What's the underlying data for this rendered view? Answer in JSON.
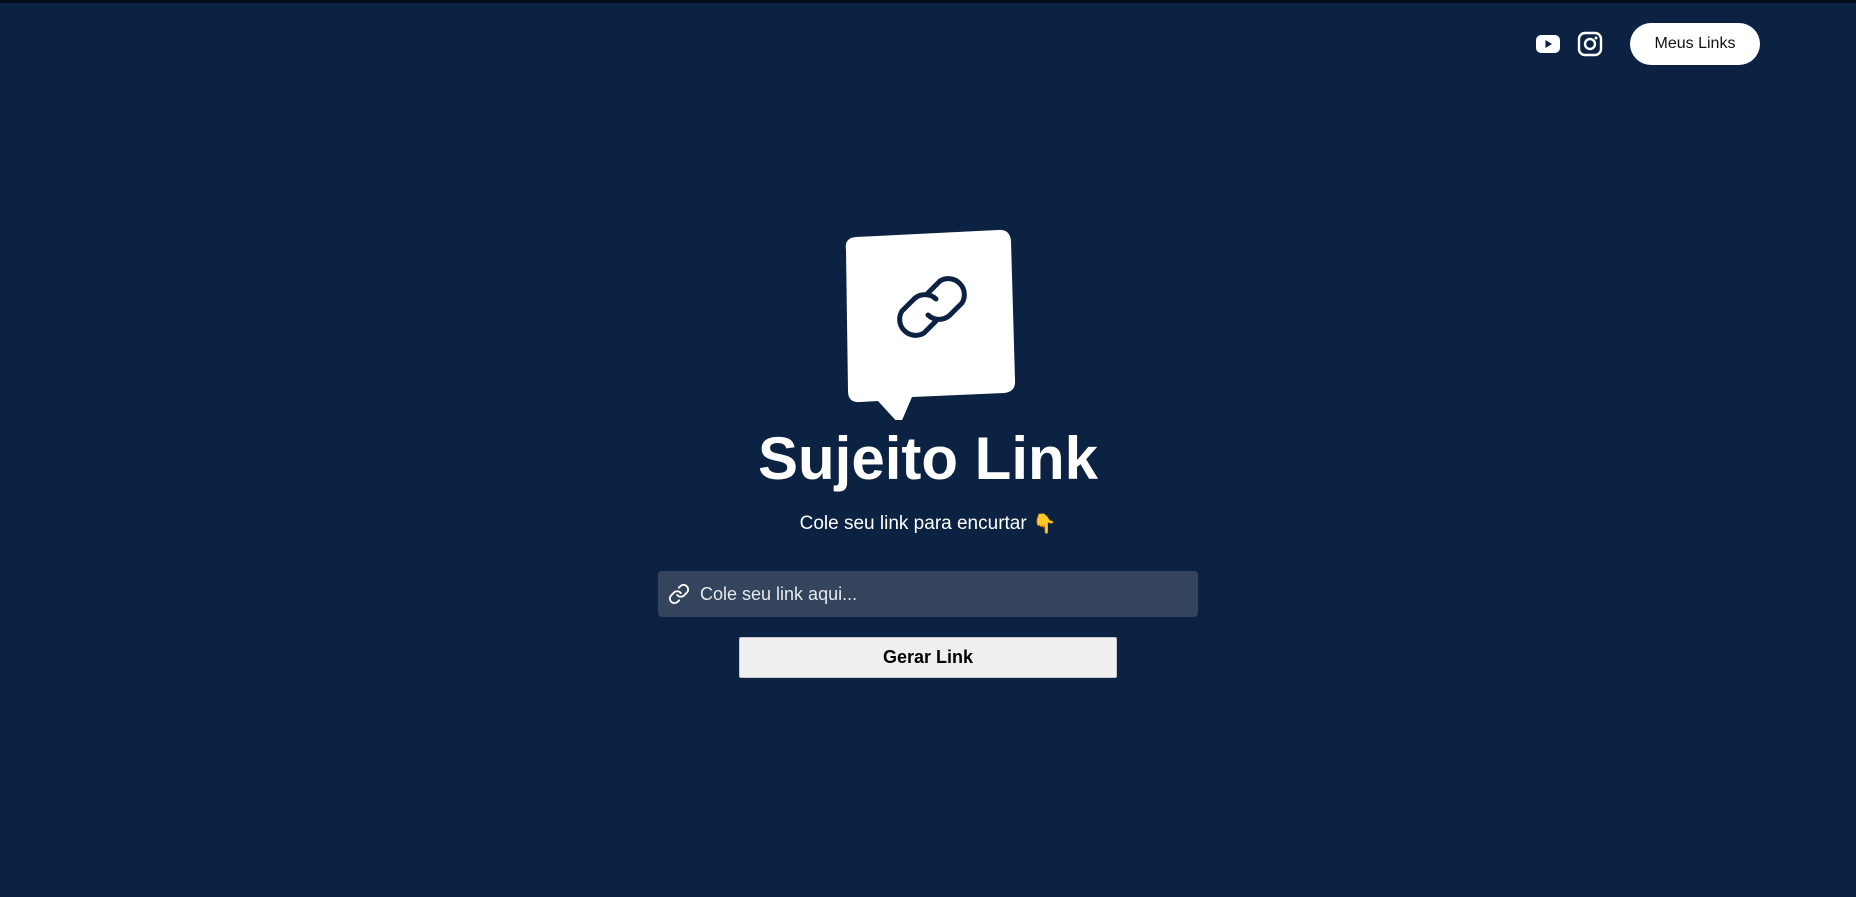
{
  "header": {
    "youtube_icon": "youtube-icon",
    "instagram_icon": "instagram-icon",
    "my_links_label": "Meus Links"
  },
  "hero": {
    "logo_icon": "chat-link-logo",
    "title": "Sujeito Link",
    "subtitle": "Cole seu link para encurtar",
    "subtitle_emoji": "👇"
  },
  "form": {
    "input_icon": "link-icon",
    "input_value": "",
    "input_placeholder": "Cole seu link aqui...",
    "submit_label": "Gerar Link"
  },
  "colors": {
    "background": "#0c2242",
    "input_background": "#34445d",
    "button_background": "#efefef",
    "pill_background": "#ffffff"
  }
}
